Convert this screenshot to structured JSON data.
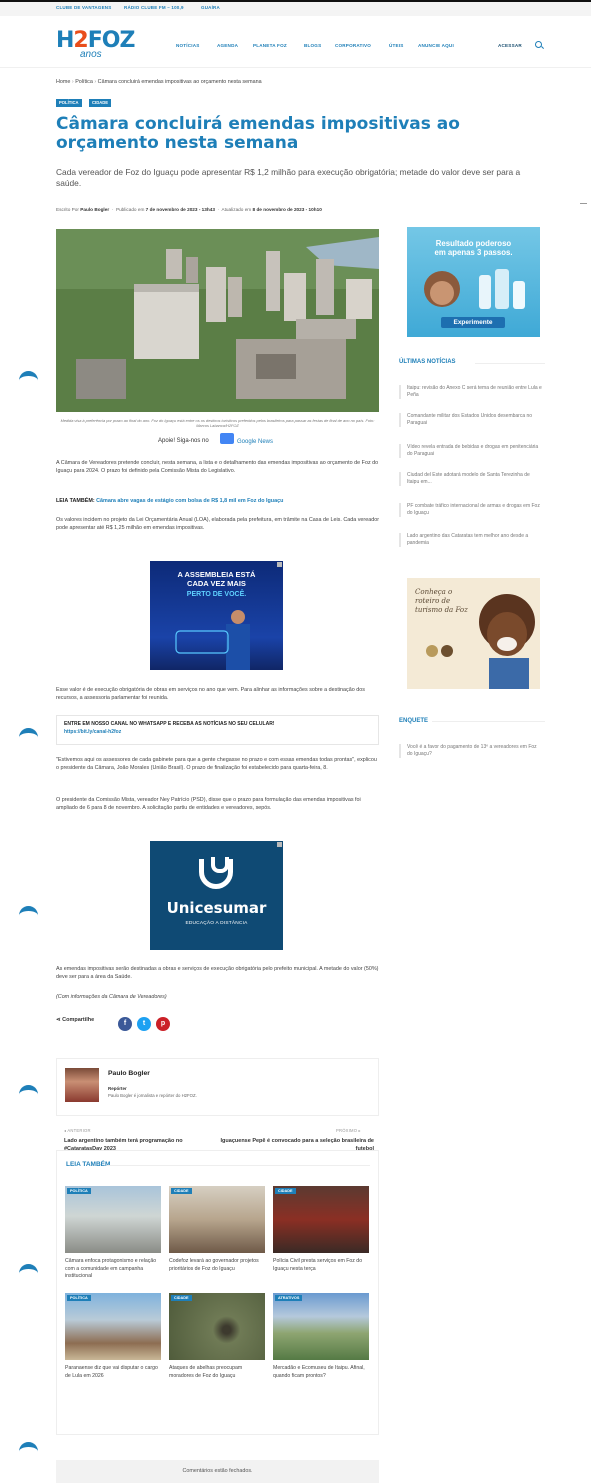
{
  "topbar": {
    "links": [
      "CLUBE DE VANTAGENS",
      "RÁDIO CLUBE FM – 100,9",
      "GUAÍRA"
    ]
  },
  "logo": {
    "main_a": "H",
    "accent": "2",
    "main_b": "FOZ",
    "sub": "anos"
  },
  "nav": {
    "items": [
      "NOTÍCIAS",
      "AGENDA",
      "PLANETA FOZ",
      "BLOGS",
      "CORPORATIVO",
      "ÚTEIS",
      "ANUNCIE AQUI"
    ],
    "login": "ACESSAR"
  },
  "breadcrumb": {
    "home": "Home",
    "sep": "›",
    "section": "Política",
    "current": "Câmara concluirá emendas impositivas ao orçamento nesta semana"
  },
  "article": {
    "categories": [
      "POLÍTICA",
      "CIDADE"
    ],
    "title": "Câmara concluirá emendas impositivas ao orçamento nesta semana",
    "lead": "Cada vereador de Foz do Iguaçu pode apresentar R$ 1,2 milhão para execução obrigatória; metade do valor deve ser para a saúde.",
    "meta_author_label": "Escrito Por",
    "meta_author": "Paulo Bogler",
    "meta_published_label": "Publicado em",
    "meta_published": "7 de novembro de 2023 - 13h43",
    "meta_updated_label": "Atualizado em",
    "meta_updated": "8 de novembro de 2023 - 10h10",
    "caption": "Medida visa à preferência por prazo ao final do ano. Foz do Iguaçu está entre os os destinos turísticos preferidos pelos brasileiros para passar as festas de final de ano no país. Foto: Marcos Labanca/H2FOZ",
    "follow": "Apoie! Siga-nos no",
    "gnews": "Google News",
    "p1": "A Câmara de Vereadores pretende concluir, nesta semana, a lista e o detalhamento das emendas impositivas ao orçamento de Foz do Iguaçu para 2024. O prazo foi definido pela Comissão Mista do Legislativo.",
    "leia_label": "LEIA TAMBÉM:",
    "leia_link": "Câmara abre vagas de estágio com bolsa de R$ 1,8 mil em Foz do Iguaçu",
    "p2": "Os valores incidem no projeto da Lei Orçamentária Anual (LOA), elaborada pela prefeitura, em trâmite na Casa de Leis. Cada vereador pode apresentar até R$ 1,25 milhão em emendas impositivas.",
    "p3": "Esse valor é de execução obrigatória de obras em serviços no ano que vem. Para alinhar as informações sobre a destinação dos recursos, a assessoria parlamentar foi reunida.",
    "whats_a": "ENTRE EM NOSSO CANAL NO WHATSAPP E RECEBA AS NOTÍCIAS NO SEU CELULAR!",
    "whats_b": "https://bit.ly/canal-h2foz",
    "p4": "\"Estivemos aqui os assessores de cada gabinete para que a gente chegasse no prazo e com essas emendas todas prontas\", explicou o presidente da Câmara, João Morales (União Brasil). O prazo de finalização foi estabelecido para quarta-feira, 8.",
    "p5": "O presidente da Comissão Mista, vereador Ney Patrício (PSD), disse que o prazo para formulação das emendas impositivas foi ampliado de 6 para 8 de novembro. A solicitação partiu de entidades e vereadores, sepós.",
    "p6": "As emendas impositivas serão destinadas a obras e serviços de execução obrigatória pelo prefeito municipal. A metade do valor (50%) deve ser para a área da Saúde.",
    "p7": "(Com informações da Câmara de Vereadores)",
    "share": "Compartilhe"
  },
  "ads": {
    "assembleia": {
      "line1": "A ASSEMBLEIA ESTÁ",
      "line2": "CADA VEZ MAIS",
      "line3": "PERTO DE VOCÊ."
    },
    "unicesumar": {
      "name": "Unicesumar",
      "sub": "EDUCAÇÃO A DISTÂNCIA"
    },
    "side1": {
      "line1": "Resultado poderoso",
      "line2": "em apenas 3 passos.",
      "button": "Experimente"
    },
    "side2": {
      "script": "Conheça o roteiro de turismo da Foz"
    }
  },
  "author": {
    "name": "Paulo Bogler",
    "role": "Repórter",
    "bio": "Paulo Bogler é jornalista e repórter do H2FOZ."
  },
  "postnav": {
    "prev_label": "◂ ANTERIOR",
    "prev_title": "Lado argentino também terá programação no #CataratasDay 2023",
    "next_label": "PRÓXIMO ▸",
    "next_title": "Iguaçuense Pepê é convocado para a seleção brasileira de futebol"
  },
  "related": {
    "heading": "LEIA TAMBÉM",
    "items": [
      {
        "tag": "POLÍTICA",
        "title": "Câmara enfoca protagonismo e relação com a comunidade em campanha institucional"
      },
      {
        "tag": "CIDADE",
        "title": "Codefoz levará ao governador projetos prioritários de Foz do Iguaçu"
      },
      {
        "tag": "CIDADE",
        "title": "Polícia Civil presta serviços em Foz do Iguaçu nesta terça"
      },
      {
        "tag": "POLÍTICA",
        "title": "Paranaense diz que vai disputar o cargo de Lula em 2026"
      },
      {
        "tag": "CIDADE",
        "title": "Ataques de abelhas preocupam moradores de Foz do Iguaçu"
      },
      {
        "tag": "ATRATIVOS",
        "title": "Mercadão e Ecomuseu de Itaipu. Afinal, quando ficam prontos?"
      }
    ]
  },
  "comments": "Comentários estão fechados.",
  "sidebar": {
    "latest_heading": "ÚLTIMAS NOTÍCIAS",
    "latest": [
      "Itaipu: revisão do Anexo C será tema de reunião entre Lula e Peña",
      "Comandante militar dos Estados Unidos desembarca no Paraguai",
      "Vídeo revela entrada de bebidas e drogas em penitenciária do Paraguai",
      "Ciudad del Este adotará modelo de Santa Terezinha de Itaipu em...",
      "PF combate tráfico internacional de armas e drogas em Foz do Iguaçu",
      "Lado argentino das Cataratas tem melhor ano desde a pandemia"
    ],
    "poll_heading": "ENQUETE",
    "poll": "Você é a favor do pagamento de 13º a vereadores em Foz do Iguaçu?"
  },
  "colors": {
    "brand": "#1e7fb8",
    "accent": "#e94e1b",
    "facebook": "#3b5998",
    "twitter": "#1da1f2",
    "pinterest": "#cb2027"
  }
}
